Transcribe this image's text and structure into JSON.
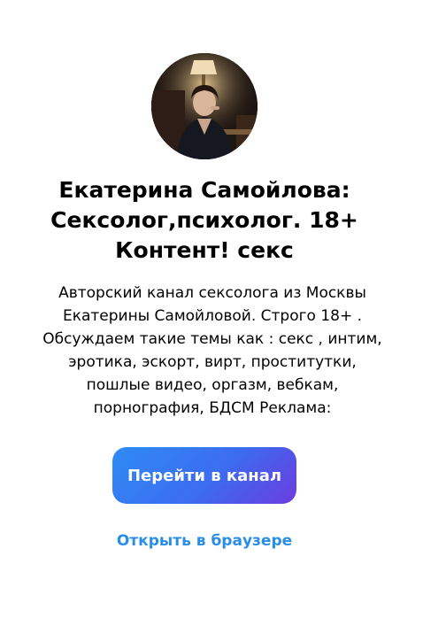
{
  "channel": {
    "title": "Екатерина Самойлова: Сексолог,психолог. 18+ Контент! секс",
    "description": "Авторский канал сексолога из Москвы Екатерины Самойловой. Строго 18+ . Обсуждаем такие темы как : секс , интим, эротика, эскорт, вирт, проститутки, пошлые видео, оргазм, вебкам, порнография, БДСМ Реклама:"
  },
  "actions": {
    "join_label": "Перейти в канал",
    "browser_label": "Открыть в браузере"
  },
  "colors": {
    "button_gradient_start": "#2f8bf5",
    "button_gradient_end": "#6b3cdf",
    "link": "#2a8ee7"
  }
}
